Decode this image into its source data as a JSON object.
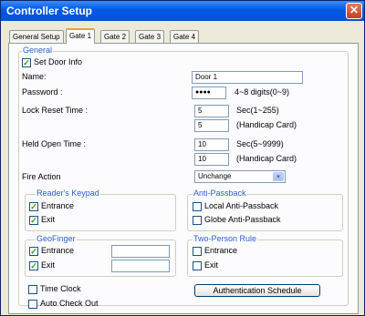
{
  "window": {
    "title": "Controller Setup",
    "close_glyph": "✕"
  },
  "tabs": [
    {
      "label": "General Setup"
    },
    {
      "label": "Gate 1"
    },
    {
      "label": "Gate 2"
    },
    {
      "label": "Gate 3"
    },
    {
      "label": "Gate 4"
    }
  ],
  "active_tab": "Gate 1",
  "general": {
    "group_title": "General",
    "set_door_info": {
      "label": "Set Door Info",
      "checked": true
    },
    "name": {
      "label": "Name:",
      "value": "Door 1"
    },
    "password": {
      "label": "Password :",
      "value": "●●●●",
      "hint": "4~8 digits(0~9)"
    },
    "lock_reset_time": {
      "label": "Lock Reset Time :",
      "value": "5",
      "hint": "Sec(1~255)",
      "handicap_value": "5",
      "handicap_hint": "(Handicap Card)"
    },
    "held_open_time": {
      "label": "Held Open Time :",
      "value": "10",
      "hint": "Sec(5~9999)",
      "handicap_value": "10",
      "handicap_hint": "(Handicap Card)"
    },
    "fire_action": {
      "label": "Fire Action",
      "value": "Unchange",
      "arrow": "▾"
    }
  },
  "readers_keypad": {
    "title": "Reader's Keypad",
    "entrance": {
      "label": "Entrance",
      "checked": true
    },
    "exit": {
      "label": "Exit",
      "checked": true
    }
  },
  "anti_passback": {
    "title": "Anti-Passback",
    "local": {
      "label": "Local Anti-Passback",
      "checked": false
    },
    "globe": {
      "label": "Globe Anti-Passback",
      "checked": false
    }
  },
  "geofinger": {
    "title": "GeoFinger",
    "entrance": {
      "label": "Entrance",
      "checked": true,
      "value": ""
    },
    "exit": {
      "label": "Exit",
      "checked": true,
      "value": ""
    }
  },
  "two_person_rule": {
    "title": "Two-Person Rule",
    "entrance": {
      "label": "Entrance",
      "checked": false
    },
    "exit": {
      "label": "Exit",
      "checked": false
    }
  },
  "time_clock": {
    "label": "Time Clock",
    "checked": false
  },
  "auto_check_out": {
    "label": "Auto Check Out",
    "checked": false
  },
  "authentication_schedule": {
    "label": "Authentication Schedule"
  },
  "check_mark": "✓",
  "colors": {
    "title_bar": "#0058e6",
    "group_title": "#2b5fc6",
    "check": "#21a121"
  }
}
